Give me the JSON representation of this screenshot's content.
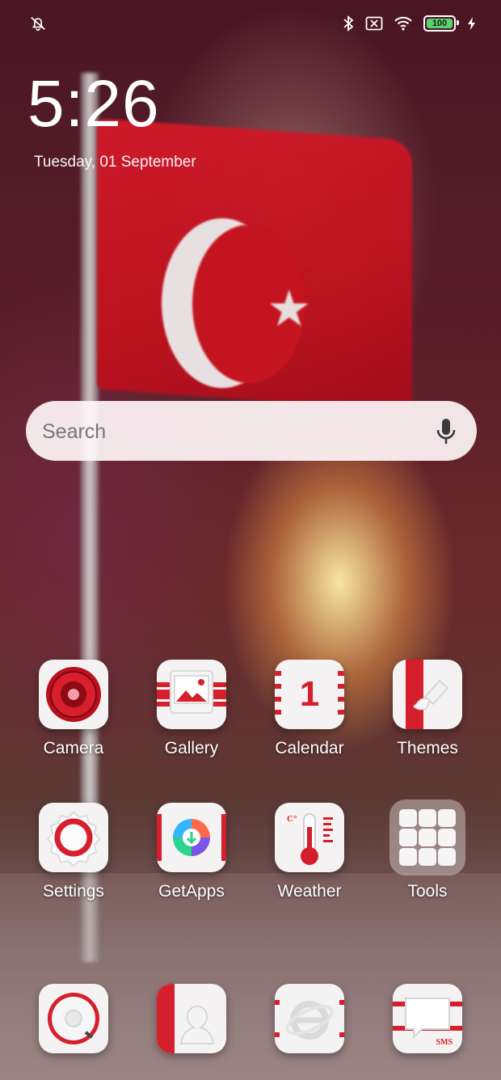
{
  "status_bar": {
    "silent_icon": "silent-bell-icon",
    "icons": [
      "bluetooth-icon",
      "sim-off-icon",
      "wifi-icon",
      "battery-icon",
      "charging-icon"
    ],
    "battery_level": "100"
  },
  "clock": {
    "time": "5:26",
    "date": "Tuesday, 01 September"
  },
  "search": {
    "placeholder": "Search",
    "mic_icon": "mic-icon"
  },
  "apps_row1": [
    {
      "label": "Camera",
      "icon": "camera-icon"
    },
    {
      "label": "Gallery",
      "icon": "gallery-icon"
    },
    {
      "label": "Calendar",
      "icon": "calendar-icon",
      "badge_text": "1"
    },
    {
      "label": "Themes",
      "icon": "themes-icon"
    }
  ],
  "apps_row2": [
    {
      "label": "Settings",
      "icon": "settings-icon"
    },
    {
      "label": "GetApps",
      "icon": "getapps-icon"
    },
    {
      "label": "Weather",
      "icon": "weather-icon",
      "unit": "C°"
    },
    {
      "label": "Tools",
      "icon": "tools-folder-icon"
    }
  ],
  "dock": [
    {
      "icon": "phone-icon"
    },
    {
      "icon": "contacts-icon"
    },
    {
      "icon": "browser-icon"
    },
    {
      "icon": "messaging-icon",
      "text": "SMS"
    }
  ],
  "colors": {
    "accent": "#d61f2c",
    "icon_bg": "#f4f2f2"
  }
}
